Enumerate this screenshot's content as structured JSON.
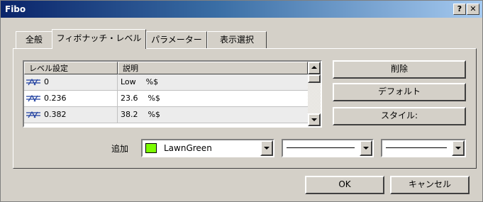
{
  "window": {
    "title": "Fibo",
    "help_label": "?",
    "close_label": "✕"
  },
  "tabs": [
    {
      "label": "全般",
      "active": false
    },
    {
      "label": "フィボナッチ・レベル",
      "active": true
    },
    {
      "label": "パラメーター",
      "active": false
    },
    {
      "label": "表示選択",
      "active": false
    }
  ],
  "levels_table": {
    "columns": [
      "レベル設定",
      "説明"
    ],
    "rows": [
      {
        "level": "0",
        "description": "Low    %$"
      },
      {
        "level": "0.236",
        "description": "23.6    %$"
      },
      {
        "level": "0.382",
        "description": "38.2    %$"
      }
    ]
  },
  "side_buttons": {
    "delete_label": "削除",
    "default_label": "デフォルト",
    "style_label": "スタイル:"
  },
  "color_row": {
    "add_label": "追加",
    "color_name": "LawnGreen",
    "color_hex": "#7cfc00"
  },
  "footer": {
    "ok_label": "OK",
    "cancel_label": "キャンセル"
  }
}
